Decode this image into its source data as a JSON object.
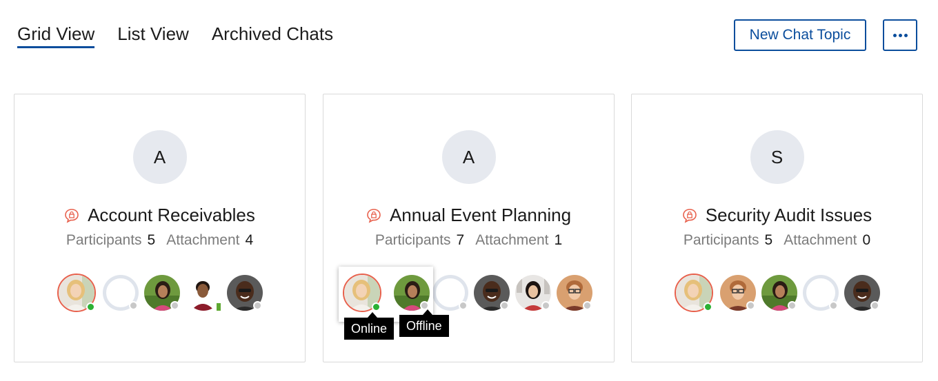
{
  "tabs": [
    {
      "label": "Grid View",
      "active": true
    },
    {
      "label": "List View",
      "active": false
    },
    {
      "label": "Archived Chats",
      "active": false
    }
  ],
  "actions": {
    "new_chat_topic": "New Chat Topic",
    "more_icon": "more-horizontal-icon"
  },
  "colors": {
    "accent": "#0a4d9c",
    "online": "#2bb134",
    "offline": "#c8c8c8",
    "owner_ring": "#e8604c",
    "chat_icon": "#e8604c"
  },
  "cards": [
    {
      "initial": "A",
      "title": "Account Receivables",
      "participants_label": "Participants",
      "participants": "5",
      "attachment_label": "Attachment",
      "attachments": "4",
      "members": [
        {
          "type": "blonde-woman",
          "status": "online",
          "owner": true
        },
        {
          "type": "placeholder",
          "status": "offline"
        },
        {
          "type": "woman-green",
          "status": "offline"
        },
        {
          "type": "man-red",
          "status": "mobile"
        },
        {
          "type": "man-smiling",
          "status": "offline"
        }
      ]
    },
    {
      "initial": "A",
      "title": "Annual Event Planning",
      "participants_label": "Participants",
      "participants": "7",
      "attachment_label": "Attachment",
      "attachments": "1",
      "members": [
        {
          "type": "blonde-woman",
          "status": "online",
          "owner": true
        },
        {
          "type": "woman-green",
          "status": "offline"
        },
        {
          "type": "placeholder",
          "status": "offline"
        },
        {
          "type": "man-smiling",
          "status": "offline"
        },
        {
          "type": "woman-city",
          "status": "offline"
        },
        {
          "type": "man-glasses",
          "status": "offline"
        }
      ],
      "tooltips": {
        "online": "Online",
        "offline": "Offline"
      }
    },
    {
      "initial": "S",
      "title": "Security Audit Issues",
      "participants_label": "Participants",
      "participants": "5",
      "attachment_label": "Attachment",
      "attachments": "0",
      "members": [
        {
          "type": "blonde-woman",
          "status": "online",
          "owner": true
        },
        {
          "type": "man-glasses",
          "status": "offline"
        },
        {
          "type": "woman-green",
          "status": "offline"
        },
        {
          "type": "placeholder",
          "status": "offline"
        },
        {
          "type": "man-smiling",
          "status": "offline"
        }
      ]
    }
  ]
}
